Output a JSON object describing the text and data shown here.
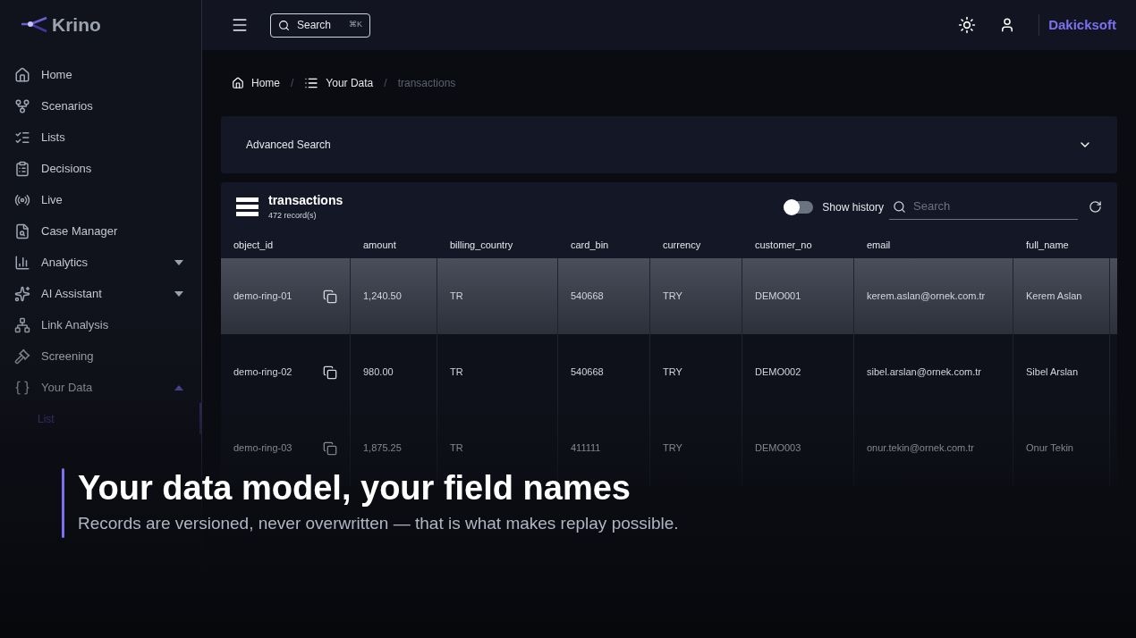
{
  "brand": {
    "name": "Krino"
  },
  "sidebar": {
    "items": [
      {
        "label": "Home"
      },
      {
        "label": "Scenarios"
      },
      {
        "label": "Lists"
      },
      {
        "label": "Decisions"
      },
      {
        "label": "Live"
      },
      {
        "label": "Case Manager"
      },
      {
        "label": "Analytics",
        "expanded": false
      },
      {
        "label": "AI Assistant",
        "expanded": false
      },
      {
        "label": "Link Analysis"
      },
      {
        "label": "Screening"
      },
      {
        "label": "Your Data",
        "expanded": true,
        "children": [
          {
            "label": "List",
            "selected": true
          }
        ]
      }
    ]
  },
  "header": {
    "search": {
      "placeholder": "Search",
      "shortcut": "⌘K"
    },
    "org": "Dakicksoft"
  },
  "breadcrumb": {
    "separator": "/",
    "items": [
      "Home",
      "Your Data",
      "transactions"
    ]
  },
  "advanced_search": {
    "label": "Advanced Search",
    "expanded": false
  },
  "table": {
    "title": "transactions",
    "count": "472 record(s)",
    "show_history": {
      "label": "Show history",
      "on": false
    },
    "search": {
      "placeholder": "Search"
    },
    "columns": [
      "object_id",
      "amount",
      "billing_country",
      "card_bin",
      "currency",
      "customer_no",
      "email",
      "full_name"
    ],
    "rows": [
      {
        "selected": true,
        "cells": [
          "demo-ring-01",
          "1,240.50",
          "TR",
          "540668",
          "TRY",
          "DEMO001",
          "kerem.aslan@ornek.com.tr",
          "Kerem Aslan"
        ]
      },
      {
        "selected": false,
        "cells": [
          "demo-ring-02",
          "980.00",
          "TR",
          "540668",
          "TRY",
          "DEMO002",
          "sibel.arslan@ornek.com.tr",
          "Sibel Arslan"
        ]
      },
      {
        "selected": false,
        "cells": [
          "demo-ring-03",
          "1,875.25",
          "TR",
          "411111",
          "TRY",
          "DEMO003",
          "onur.tekin@ornek.com.tr",
          "Onur Tekin"
        ]
      }
    ]
  },
  "caption": {
    "title": "Your data model, your field names",
    "subtitle": "Records are versioned, never overwritten — that is what makes replay possible."
  }
}
